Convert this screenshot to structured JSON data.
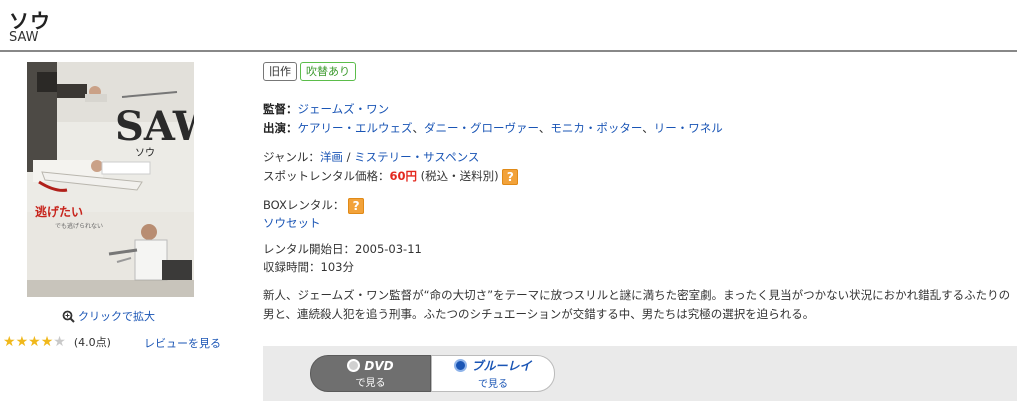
{
  "header": {
    "title": "ソウ",
    "subtitle": "SAW"
  },
  "poster": {
    "logo_text": "SAW",
    "kana": "ソウ",
    "tagline": "逃げたい",
    "tagline_sub": "でも逃げられない"
  },
  "zoom": {
    "label": "クリックで拡大"
  },
  "rating": {
    "stars": 4,
    "max": 5,
    "score_text": "(4.0点)",
    "review_link": "レビューを見る"
  },
  "badges": {
    "old": "旧作",
    "dub": "吹替あり"
  },
  "credits": {
    "director_label": "監督：",
    "director": "ジェームズ・ワン",
    "cast_label": "出演：",
    "cast": [
      "ケアリー・エルウェズ",
      "ダニー・グローヴァー",
      "モニカ・ポッター",
      "リー・ワネル"
    ],
    "cast_sep": "、"
  },
  "genre": {
    "label": "ジャンル：",
    "items": [
      "洋画",
      "ミステリー・サスペンス"
    ],
    "sep": " / "
  },
  "spot": {
    "label": "スポットレンタル価格：",
    "price": "60円",
    "note": " (税込・送料別) "
  },
  "box": {
    "label": "BOXレンタル：",
    "set_link": "ソウセット"
  },
  "rental_start": {
    "label": "レンタル開始日：",
    "value": "2005-03-11"
  },
  "runtime": {
    "label": "収録時間：",
    "value": "103分"
  },
  "description": "新人、ジェームズ・ワン監督が“命の大切さ”をテーマに放つスリルと謎に満ちた密室劇。まったく見当がつかない状況におかれ錯乱するふたりの男と、連続殺人犯を追う刑事。ふたつのシチュエーションが交錯する中、男たちは究極の選択を迫られる。",
  "formats": {
    "dvd": {
      "label": "DVD",
      "sub": "で見る"
    },
    "bluray": {
      "label": "ブルーレイ",
      "sub": "で見る"
    }
  },
  "icons": {
    "help": "?"
  },
  "colors": {
    "price": "#e3281e",
    "link": "#1a55b5",
    "star": "#f0b81c",
    "badge_green": "#5bbd4a",
    "help_icon": "#f2a23a"
  }
}
